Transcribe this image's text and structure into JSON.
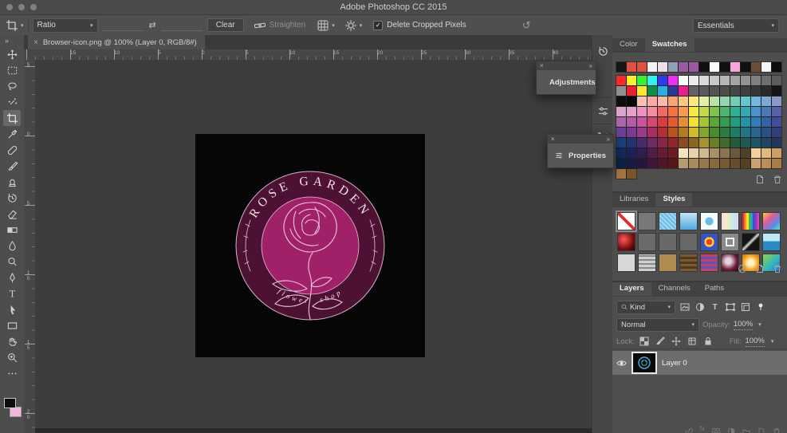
{
  "window": {
    "title": "Adobe Photoshop CC 2015"
  },
  "options_bar": {
    "tool": "crop",
    "ratio": "Ratio",
    "width_value": "",
    "height_value": "",
    "clear": "Clear",
    "straighten": "Straighten",
    "delete_cropped": "Delete Cropped Pixels",
    "check": "✓",
    "workspace": "Essentials"
  },
  "tab": {
    "title": "Browser-icon.png @ 100% (Layer 0, RGB/8#)",
    "close": "×"
  },
  "rulers": {
    "horizontal": [
      "15",
      "10",
      "5",
      "0",
      "5",
      "10",
      "15",
      "20",
      "25",
      "30",
      "35",
      "40"
    ],
    "vertical": [
      "5",
      "0",
      "5",
      "10",
      "15",
      "20"
    ]
  },
  "toolbar": {
    "expand": "»",
    "tools": [
      {
        "name": "move"
      },
      {
        "name": "marquee"
      },
      {
        "name": "lasso"
      },
      {
        "name": "magic-wand"
      },
      {
        "name": "crop",
        "active": true
      },
      {
        "name": "eyedropper"
      },
      {
        "name": "healing-brush"
      },
      {
        "name": "brush"
      },
      {
        "name": "clone-stamp"
      },
      {
        "name": "history-brush"
      },
      {
        "name": "eraser"
      },
      {
        "name": "gradient"
      },
      {
        "name": "blur"
      },
      {
        "name": "dodge"
      },
      {
        "name": "pen"
      },
      {
        "name": "type"
      },
      {
        "name": "path-selection"
      },
      {
        "name": "shape"
      },
      {
        "name": "hand"
      },
      {
        "name": "zoom"
      },
      {
        "name": "more"
      }
    ],
    "foreground_color": "#0d0d0d",
    "background_color": "#f2b6dc"
  },
  "canvas": {
    "background": "#060606",
    "logo": {
      "title": "ROSE GARDEN",
      "subtitle": "flower shop",
      "outer_ring_color": "#4d1233",
      "inner_circle_color": "#a12169",
      "line_color": "#ecc6da",
      "text_color": "#f4e3ec"
    }
  },
  "dock": {
    "icons": [
      "history",
      "sliders",
      "tool-presets"
    ]
  },
  "floating": {
    "adjustments": {
      "label": "Adjustments",
      "close": "×",
      "collapse": "»"
    },
    "properties": {
      "label": "Properties",
      "close": "×",
      "collapse": "»"
    }
  },
  "panels": {
    "swatches": {
      "tabs": [
        "Color",
        "Swatches"
      ],
      "active_tab": "Swatches",
      "recent": [
        "#161616",
        "#df5240",
        "#df5240",
        "#f2f2f2",
        "#eedfe8",
        "#8ea0b5",
        "#9a5aa2",
        "#9a5aa2",
        "#101010",
        "#fbfbfb",
        "#101010",
        "#f3a6d7",
        "#101010",
        "#6b4e35",
        "#f5f5f5",
        "#0c0c0c"
      ],
      "rows": [
        [
          "#fd2828",
          "#fcf32e",
          "#32f42c",
          "#2ff3ef",
          "#2e3af0",
          "#f22ef2",
          "#fefefe",
          "#ececec",
          "#dadada",
          "#c8c8c8",
          "#b6b6b6",
          "#a4a4a4",
          "#929292",
          "#808080",
          "#6e6e6e",
          "#5c5c5c"
        ],
        [
          "#8f8f8f",
          "#e9202e",
          "#ffe72e",
          "#0f8e47",
          "#28aee3",
          "#2a3a92",
          "#eb1e8e",
          "#636363",
          "#5b5b5b",
          "#545454",
          "#4d4d4d",
          "#464646",
          "#3f3f3f",
          "#373737",
          "#2a2a2a",
          "#151515"
        ],
        [
          "#0e0e0e",
          "#070707",
          "#f8c1b4",
          "#f7aca4",
          "#f9bba8",
          "#f7a674",
          "#fbc781",
          "#fdea7e",
          "#e3f09d",
          "#b9e4a5",
          "#92d7b3",
          "#72ccb6",
          "#62c7d1",
          "#70b7e1",
          "#7da9d9",
          "#8b99c8"
        ],
        [
          "#d9a5ce",
          "#e4a0cb",
          "#ed91c0",
          "#f18ea0",
          "#ef6a62",
          "#f27341",
          "#f69c4e",
          "#f7e943",
          "#c3da45",
          "#7ec351",
          "#4eb56c",
          "#31af91",
          "#35a7b6",
          "#4c91c9",
          "#4b7ab8",
          "#5960a8"
        ],
        [
          "#aa66ac",
          "#b45da2",
          "#ca559d",
          "#d64871",
          "#da3c3e",
          "#e15c2d",
          "#e1912d",
          "#f2e230",
          "#a5c631",
          "#5ca738",
          "#319f50",
          "#219d7e",
          "#2195a6",
          "#317db6",
          "#3163a6",
          "#414d98"
        ],
        [
          "#6b3e99",
          "#7b3b8d",
          "#983b89",
          "#a53061",
          "#b13034",
          "#b65520",
          "#b67b20",
          "#ccbe2b",
          "#85a42b",
          "#4b8b30",
          "#2b7b44",
          "#207b65",
          "#207588",
          "#2a6490",
          "#2a5086",
          "#343e79"
        ],
        [
          "#19417d",
          "#26326f",
          "#462b6f",
          "#6f2b65",
          "#8b2545",
          "#90252a",
          "#8b4b20",
          "#8b6620",
          "#a69525",
          "#6a8025",
          "#406b2a",
          "#255b39",
          "#205b51",
          "#205569",
          "#204661",
          "#25355d"
        ],
        [
          "#112b5d",
          "#1b2253",
          "#2f1d4f",
          "#4f1d47",
          "#651b31",
          "#6c1b1e",
          "#f3e4c3",
          "#e5d4ad",
          "#ccb98f",
          "#a99167",
          "#8b7451",
          "#6c583c",
          "#50402b",
          "#f1d09b",
          "#e1b97b",
          "#cca063"
        ],
        [
          "#0d2148",
          "#151b41",
          "#251640",
          "#401539",
          "#531527",
          "#591518",
          "#b89a6c",
          "#a88a5c",
          "#97794c",
          "#87693f",
          "#765a34",
          "#654c2a",
          "#543f22",
          "#caa36b",
          "#b98f57",
          "#a87c45"
        ]
      ],
      "partial_row": [
        "#a5763f",
        "#7a5429"
      ]
    },
    "styles": {
      "tabs": [
        "Libraries",
        "Styles"
      ],
      "active_tab": "Styles",
      "items": [
        {
          "bg": "#ffffff",
          "slash": true,
          "selected": true
        },
        {
          "bg": "#787878"
        },
        {
          "bg": "repeating-linear-gradient(45deg,#9fd9f2 0 2px,#6cbce6 2px 4px)"
        },
        {
          "bg": "linear-gradient(#bfe7f7,#4fa9dc)"
        },
        {
          "bg": "radial-gradient(circle at 50% 50%,#6cbce6 32%,#f4fbff 36%)"
        },
        {
          "bg": "linear-gradient(90deg,#f7d4e8,#fbe9c8,#d8f0c8,#c8e4f5,#e2d2ef)"
        },
        {
          "bg": "linear-gradient(90deg,#e83030 0 13%,#f79422 13% 25%,#f7e32a 25% 38%,#47b747 38% 50%,#2a9ad8 50% 63%,#3a53c4 63% 75%,#8b3ac4 75% 88%,#e040b0 88%)"
        },
        {
          "bg": "linear-gradient(135deg,#f2d22e,#e85a9b 35%,#5a8be8 70%,#5ae8b0)"
        },
        {
          "bg": "radial-gradient(circle at 35% 35%,#ff5a5a,#7a0f0f 60%,#1a0404)"
        },
        {
          "bg": "#6a6a6a"
        },
        {
          "bg": "#696969"
        },
        {
          "bg": "#686868"
        },
        {
          "bg": "radial-gradient(circle,#f73a2a 0 25%,#f7d22a 25% 42%,#3a53c4 42%)"
        },
        {
          "bg": "#8a8a8a",
          "outline": true
        },
        {
          "bg": "linear-gradient(135deg,#141414 40%,#dddddd 50%,#141414 60%)"
        },
        {
          "bg": "linear-gradient(180deg,#bfe9fb 0 45%,#2a8ac4 45%)"
        },
        {
          "bg": "#d8d8d8"
        },
        {
          "bg": "repeating-linear-gradient(0deg,#cfcfcf 0 3px,#8a8a8a 3px 5px)"
        },
        {
          "bg": "#b08d4f"
        },
        {
          "bg": "repeating-linear-gradient(0deg,#7a5a30 0 3px,#4f3a1a 3px 6px)"
        },
        {
          "bg": "repeating-linear-gradient(0deg,#d83a5a 0 3px,#4a5ac8 3px 6px)"
        },
        {
          "bg": "radial-gradient(circle at 40% 40%,#e8d0e0 20%,#6b1a3a 60%,#2a0a14)"
        },
        {
          "bg": "radial-gradient(circle,#fdf3c2 25%,#f7a61e 60%,#c46a10)"
        },
        {
          "bg": "linear-gradient(135deg,#8fd84a,#2ab4c4 60%,#2a6ac4)"
        }
      ]
    },
    "layers": {
      "tabs": [
        "Layers",
        "Channels",
        "Paths"
      ],
      "active_tab": "Layers",
      "kind": "Kind",
      "blend_mode": "Normal",
      "opacity_label": "Opacity:",
      "opacity": "100%",
      "lock_label": "Lock:",
      "fill_label": "Fill:",
      "fill": "100%",
      "items": [
        {
          "name": "Layer 0",
          "visible": true,
          "selected": true
        }
      ]
    }
  }
}
